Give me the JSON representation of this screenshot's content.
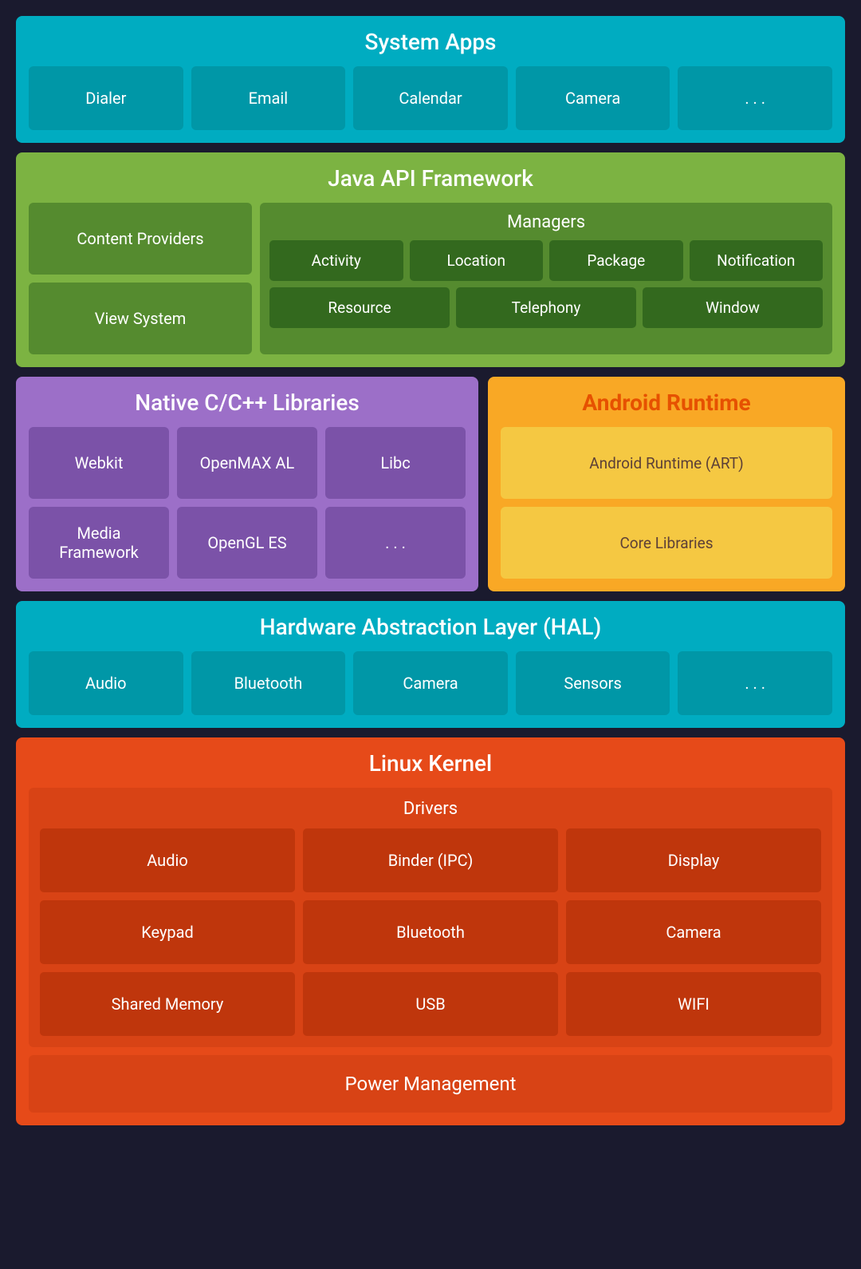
{
  "system_apps": {
    "title": "System Apps",
    "items": [
      "Dialer",
      "Email",
      "Calendar",
      "Camera",
      ". . ."
    ]
  },
  "java_api": {
    "title": "Java API Framework",
    "left_items": [
      "Content Providers",
      "View System"
    ],
    "managers_title": "Managers",
    "managers_row1": [
      "Activity",
      "Location",
      "Package",
      "Notification"
    ],
    "managers_row2": [
      "Resource",
      "Telephony",
      "Window"
    ]
  },
  "native_libs": {
    "title": "Native C/C++ Libraries",
    "items": [
      "Webkit",
      "OpenMAX AL",
      "Libc",
      "Media Framework",
      "OpenGL ES",
      ". . ."
    ]
  },
  "android_runtime": {
    "title": "Android Runtime",
    "items": [
      "Android Runtime (ART)",
      "Core Libraries"
    ]
  },
  "hal": {
    "title": "Hardware Abstraction Layer (HAL)",
    "items": [
      "Audio",
      "Bluetooth",
      "Camera",
      "Sensors",
      ". . ."
    ]
  },
  "linux_kernel": {
    "title": "Linux Kernel",
    "drivers_title": "Drivers",
    "drivers": [
      "Audio",
      "Binder (IPC)",
      "Display",
      "Keypad",
      "Bluetooth",
      "Camera",
      "Shared Memory",
      "USB",
      "WIFI"
    ],
    "power_management": "Power Management"
  }
}
